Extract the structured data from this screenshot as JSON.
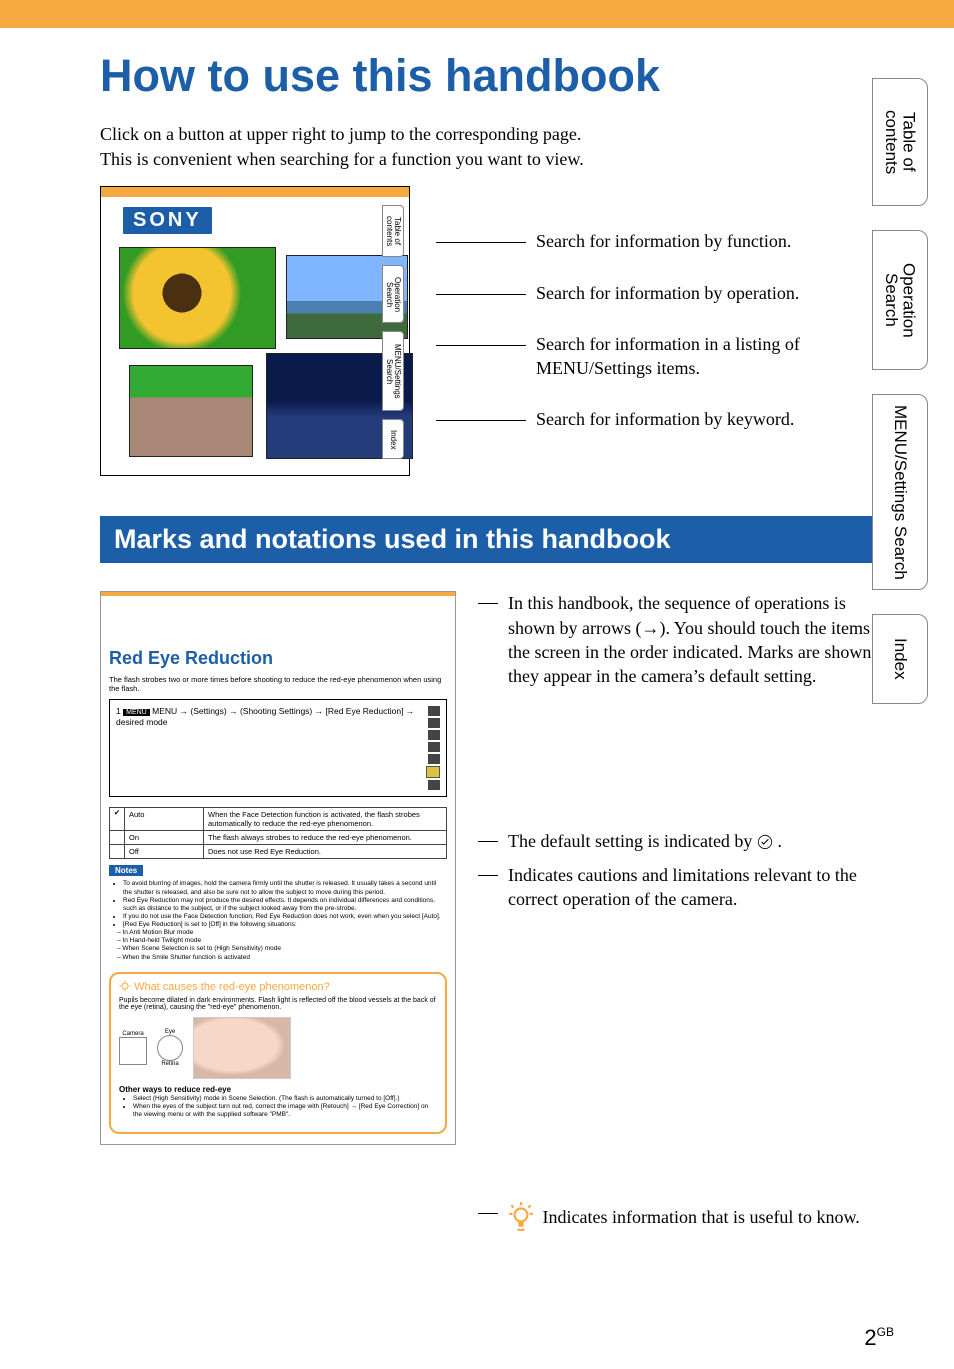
{
  "page": {
    "title": "How to use this handbook",
    "intro_line1": "Click on a button at upper right to jump to the corresponding page.",
    "intro_line2": "This is convenient when searching for a function you want to view.",
    "number": "2",
    "number_suffix": "GB"
  },
  "preview": {
    "brand": "SONY",
    "tabs": {
      "toc": "Table of\ncontents",
      "ops": "Operation\nSearch",
      "menu": "MENU/Settings\nSearch",
      "idx": "Index"
    }
  },
  "search_hints": {
    "by_function": "Search for information by function.",
    "by_operation": "Search for information by operation.",
    "by_menu": "Search for information in a listing of MENU/Settings items.",
    "by_keyword": "Search for information by keyword."
  },
  "right_tabs": {
    "toc": "Table of\ncontents",
    "ops": "Operation\nSearch",
    "menu": "MENU/Settings\nSearch",
    "idx": "Index"
  },
  "section_bar": "Marks and notations used in this handbook",
  "callouts": {
    "sequence": "In this handbook, the sequence of operations is shown by arrows (→). You should touch the items on the screen in the order indicated. Marks are shown as they appear in the camera’s default setting.",
    "default_prefix": "The default setting is indicated by ",
    "default_suffix": ".",
    "notes": "Indicates cautions and limitations relevant to the correct operation of the camera.",
    "tip": " Indicates information that is useful to know."
  },
  "sample_page": {
    "title": "Red Eye Reduction",
    "lead": "The flash strobes two or more times before shooting to reduce the red-eye phenomenon when using the flash.",
    "step_prefix": "1",
    "step_text": "MENU →  (Settings) →  (Shooting Settings) → [Red Eye Reduction] → desired mode",
    "table": {
      "rows": [
        {
          "mark": "✔",
          "label": "Auto",
          "desc": "When the Face Detection function is activated, the flash strobes automatically to reduce the red-eye phenomenon."
        },
        {
          "mark": "",
          "label": "On",
          "desc": "The flash always strobes to reduce the red-eye phenomenon."
        },
        {
          "mark": "",
          "label": "Off",
          "desc": "Does not use Red Eye Reduction."
        }
      ]
    },
    "notes_label": "Notes",
    "notes": [
      "To avoid blurring of images, hold the camera firmly until the shutter is released. It usually takes a second until the shutter is released, and also be sure not to allow the subject to move during this period.",
      "Red Eye Reduction may not produce the desired effects. It depends on individual differences and conditions, such as distance to the subject, or if the subject looked away from the pre-strobe.",
      "If you do not use the Face Detection function, Red Eye Reduction does not work, even when you select [Auto].",
      "[Red Eye Reduction] is set to [Off] in the following situations:",
      "– In Anti Motion Blur mode",
      "– In Hand-held Twilight mode",
      "– When Scene Selection is set to  (High Sensitivity) mode",
      "– When the Smile Shutter function is activated"
    ],
    "tip_title": "What causes the red-eye phenomenon?",
    "tip_lead": "Pupils become dilated in dark environments. Flash light is reflected off the blood vessels at the back of the eye (retina), causing the \"red-eye\" phenomenon.",
    "diagram": {
      "camera": "Camera",
      "eye": "Eye",
      "retina": "Retina"
    },
    "other_ways_title": "Other ways to reduce red-eye",
    "other_ways": [
      "Select  (High Sensitivity) mode in Scene Selection. (The flash is automatically turned to [Off].)",
      "When the eyes of the subject turn out red, correct the image with [Retouch] → [Red Eye Correction] on the viewing menu or with the supplied software \"PMB\"."
    ]
  }
}
